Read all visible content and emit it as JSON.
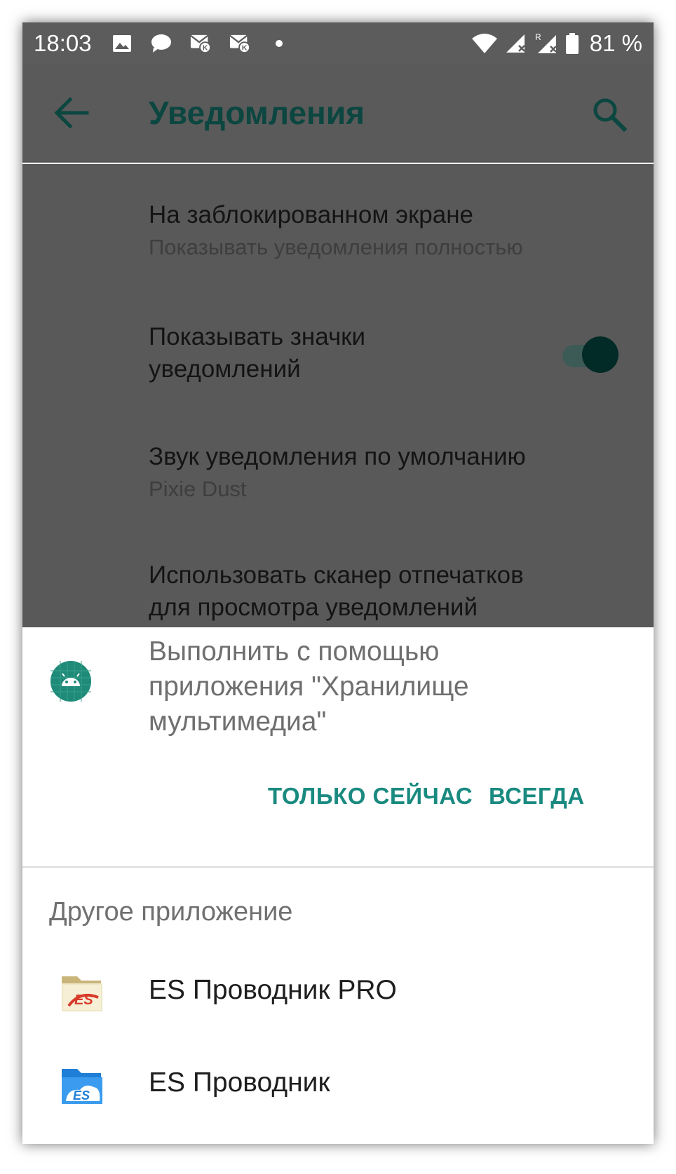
{
  "status_bar": {
    "time": "18:03",
    "battery": "81 %",
    "left_icons": [
      "image-icon",
      "chat-icon",
      "mail-icon",
      "mail-icon",
      "dot-icon"
    ],
    "right_icons": [
      "wifi-icon",
      "signal-icon",
      "signal-roaming-icon",
      "battery-icon"
    ]
  },
  "app_bar": {
    "title": "Уведомления",
    "back_icon": "arrow-left-icon",
    "search_icon": "search-icon"
  },
  "settings": {
    "items": [
      {
        "title": "На заблокированном экране",
        "subtitle": "Показывать уведомления полностью"
      },
      {
        "title_line1": "Показывать значки",
        "title_line2": "уведомлений",
        "toggle_on": true
      },
      {
        "title": "Звук уведомления по умолчанию",
        "subtitle": "Pixie Dust"
      },
      {
        "title_line1": "Использовать сканер отпечатков",
        "title_line2": "для просмотра уведомлений"
      }
    ]
  },
  "sheet": {
    "title_line1": "Выполнить с помощью",
    "title_line2": "приложения \"Хранилище",
    "title_line3": "мультимедиа\"",
    "app_icon": "android-icon",
    "btn_once": "ТОЛЬКО СЕЙЧАС",
    "btn_always": "ВСЕГДА",
    "other_label": "Другое приложение",
    "apps": [
      {
        "label": "ES Проводник PRO",
        "icon": "es-explorer-pro-icon"
      },
      {
        "label": "ES Проводник",
        "icon": "es-explorer-icon"
      }
    ]
  },
  "colors": {
    "accent": "#1a8a80",
    "title_dark": "#0c4640",
    "dim_bg": "#595959"
  }
}
